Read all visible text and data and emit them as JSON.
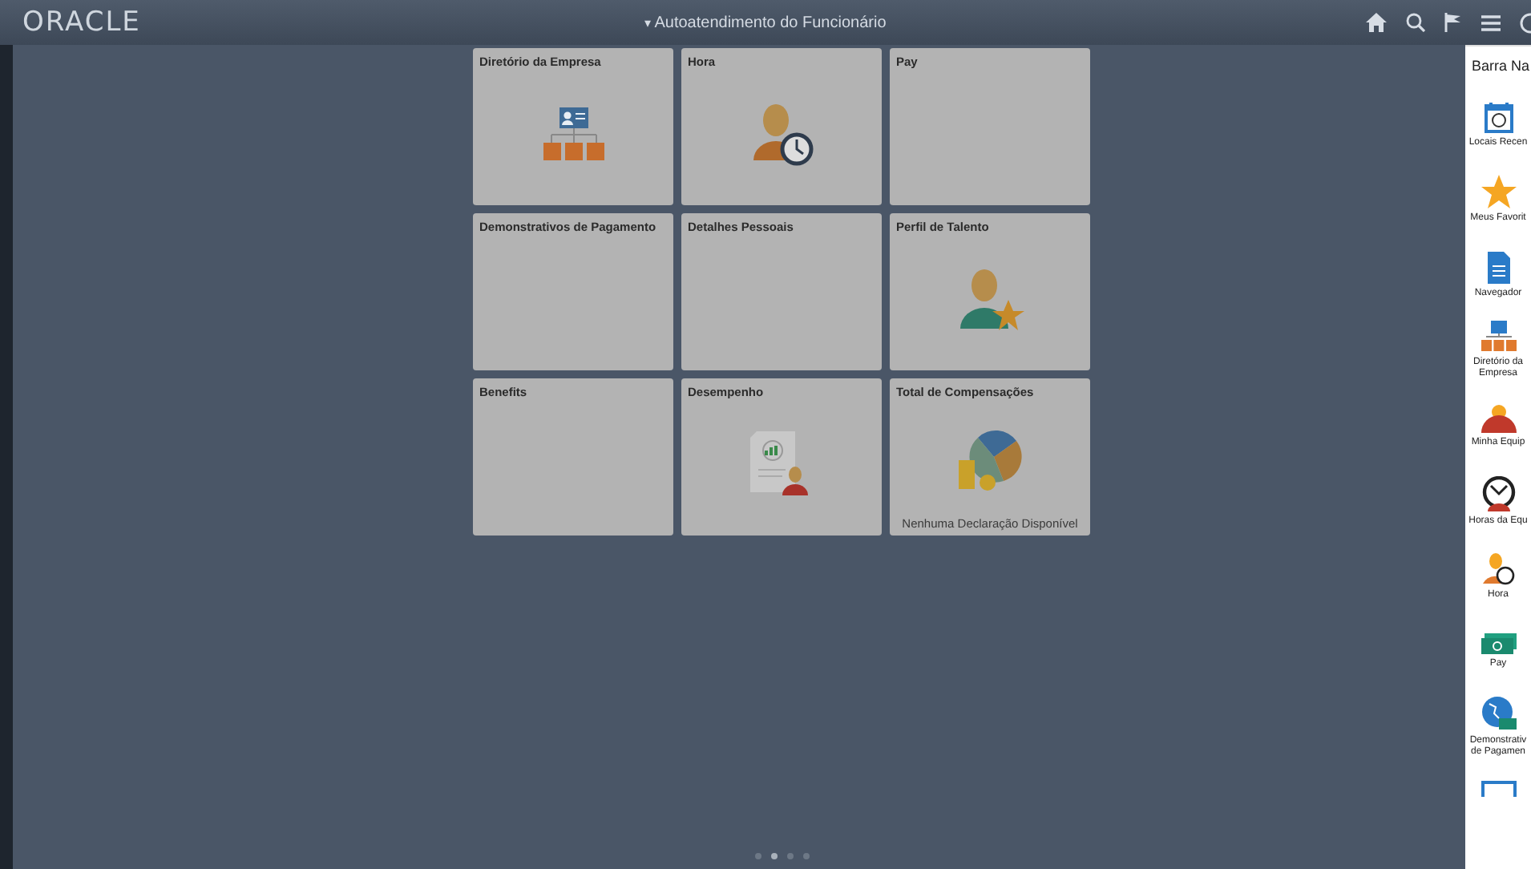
{
  "header": {
    "logo": "ORACLE",
    "title_caret": "▾",
    "title": "Autoatendimento do Funcionário"
  },
  "tiles": [
    {
      "title": "Diretório da Empresa"
    },
    {
      "title": "Hora"
    },
    {
      "title": "Pay"
    },
    {
      "title": "Demonstrativos de Pagamento"
    },
    {
      "title": "Detalhes Pessoais"
    },
    {
      "title": "Perfil de Talento"
    },
    {
      "title": "Benefits"
    },
    {
      "title": "Desempenho"
    },
    {
      "title": "Total de Compensações",
      "footer": "Nenhuma Declaração Disponível"
    }
  ],
  "page_dots": [
    {
      "selected": false
    },
    {
      "selected": true
    },
    {
      "selected": false
    },
    {
      "selected": false
    }
  ],
  "sidebar": {
    "title": "Barra Na",
    "items": [
      {
        "lines": [
          "Locais Recen"
        ]
      },
      {
        "lines": [
          "Meus Favorit"
        ]
      },
      {
        "lines": [
          "Navegador"
        ]
      },
      {
        "lines": [
          "Diretório da",
          "Empresa"
        ]
      },
      {
        "lines": [
          "Minha Equip"
        ]
      },
      {
        "lines": [
          "Horas da Equ"
        ]
      },
      {
        "lines": [
          "Hora"
        ]
      },
      {
        "lines": [
          "Pay"
        ]
      },
      {
        "lines": [
          "Demonstrativ",
          "de Pagamen"
        ]
      }
    ]
  }
}
